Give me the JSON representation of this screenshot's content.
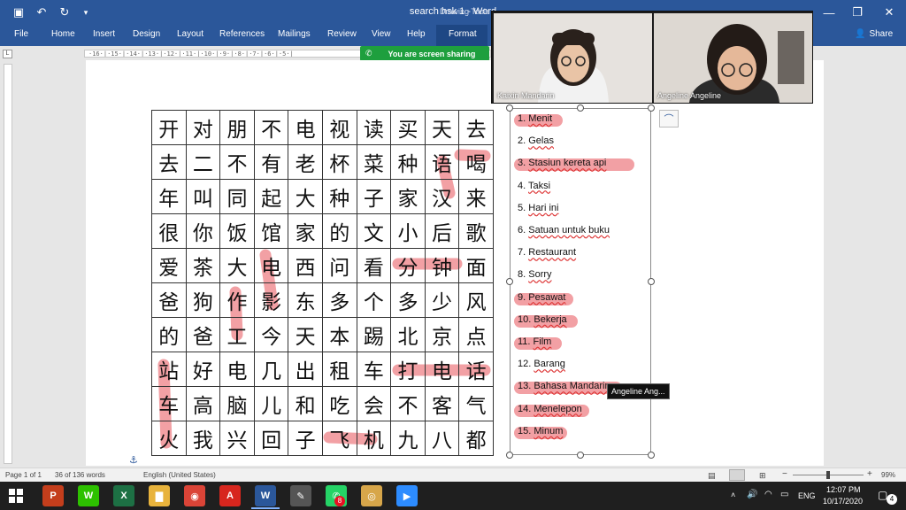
{
  "window": {
    "title": "search hsk 1  -  Word",
    "context_tab": "Drawing Tools",
    "minimize": "—",
    "restore": "❐",
    "close": "✕"
  },
  "ribbon": {
    "tabs": [
      "File",
      "Home",
      "Insert",
      "Design",
      "Layout",
      "References",
      "Mailings",
      "Review",
      "View",
      "Help",
      "Format"
    ],
    "share_label": "Share"
  },
  "share_banner": {
    "text": "You are screen sharing"
  },
  "ruler": {
    "text": "·16·|·15·|·14·|·13·|·12·|·11·|·10·|·9·|·8·|·7·|·6·|·5·|"
  },
  "grid": {
    "rows": [
      [
        "开",
        "对",
        "朋",
        "不",
        "电",
        "视",
        "读",
        "买",
        "天",
        "去"
      ],
      [
        "去",
        "二",
        "不",
        "有",
        "老",
        "杯",
        "菜",
        "种",
        "语",
        "喝"
      ],
      [
        "年",
        "叫",
        "同",
        "起",
        "大",
        "种",
        "子",
        "家",
        "汉",
        "来"
      ],
      [
        "很",
        "你",
        "饭",
        "馆",
        "家",
        "的",
        "文",
        "小",
        "后",
        "歌"
      ],
      [
        "爱",
        "茶",
        "大",
        "电",
        "西",
        "问",
        "看",
        "分",
        "钟",
        "面"
      ],
      [
        "爸",
        "狗",
        "作",
        "影",
        "东",
        "多",
        "个",
        "多",
        "少",
        "风"
      ],
      [
        "的",
        "爸",
        "工",
        "今",
        "天",
        "本",
        "踢",
        "北",
        "京",
        "点"
      ],
      [
        "站",
        "好",
        "电",
        "几",
        "出",
        "租",
        "车",
        "打",
        "电",
        "话"
      ],
      [
        "车",
        "高",
        "脑",
        "儿",
        "和",
        "吃",
        "会",
        "不",
        "客",
        "气"
      ],
      [
        "火",
        "我",
        "兴",
        "回",
        "子",
        "飞",
        "机",
        "九",
        "八",
        "都"
      ]
    ]
  },
  "answer_list": {
    "items": [
      {
        "num": "1.",
        "text": "Menit",
        "highlight": true
      },
      {
        "num": "2.",
        "text": "Gelas",
        "highlight": false
      },
      {
        "num": "3.",
        "text": "Stasiun kereta api",
        "highlight": true
      },
      {
        "num": "4.",
        "text": "Taksi",
        "highlight": false
      },
      {
        "num": "5.",
        "text": "Hari ini",
        "highlight": false
      },
      {
        "num": "6.",
        "text": "Satuan untuk buku",
        "highlight": false
      },
      {
        "num": "7.",
        "text": "Restaurant",
        "highlight": false
      },
      {
        "num": "8.",
        "text": "Sorry",
        "highlight": false
      },
      {
        "num": "9.",
        "text": "Pesawat",
        "highlight": true
      },
      {
        "num": "10.",
        "text": "Bekerja",
        "highlight": true
      },
      {
        "num": "11.",
        "text": "Film",
        "highlight": true
      },
      {
        "num": "12.",
        "text": "Barang",
        "highlight": false
      },
      {
        "num": "13.",
        "text": "Bahasa Mandarin",
        "highlight": true
      },
      {
        "num": "14.",
        "text": "Menelepon",
        "highlight": true
      },
      {
        "num": "15.",
        "text": "Minum",
        "highlight": true
      }
    ],
    "highlight_color": "#e8525a"
  },
  "video": {
    "participants": [
      {
        "name": "Kaixin Mandarin"
      },
      {
        "name": "Angeline Angeline"
      }
    ]
  },
  "tooltip": {
    "text": "Angeline Ang..."
  },
  "statusbar": {
    "page": "Page 1 of 1",
    "words": "36 of 136 words",
    "language": "English (United States)",
    "zoom": "99%",
    "zoom_minus": "−",
    "zoom_plus": "+"
  },
  "taskbar": {
    "apps": [
      {
        "name": "powerpoint-app",
        "glyph": "P",
        "color": "#c43e1c"
      },
      {
        "name": "wechat-app",
        "glyph": "W",
        "color": "#2dc100"
      },
      {
        "name": "excel-app",
        "glyph": "X",
        "color": "#1d7044"
      },
      {
        "name": "file-explorer-app",
        "glyph": "▇",
        "color": "#e8b33c"
      },
      {
        "name": "chrome-app",
        "glyph": "◉",
        "color": "#db4437"
      },
      {
        "name": "acrobat-app",
        "glyph": "A",
        "color": "#d7261e"
      },
      {
        "name": "word-app",
        "glyph": "W",
        "color": "#2b579a"
      },
      {
        "name": "paint-app",
        "glyph": "✎",
        "color": "#555"
      },
      {
        "name": "whatsapp-app",
        "glyph": "✆",
        "color": "#25d366"
      },
      {
        "name": "camera-app",
        "glyph": "◎",
        "color": "#d7a64a"
      },
      {
        "name": "zoom-app",
        "glyph": "▶",
        "color": "#2d8cff"
      }
    ],
    "whatsapp_badge": "8",
    "language": "ENG",
    "time": "12:07 PM",
    "date": "10/17/2020",
    "notifications": "4"
  }
}
